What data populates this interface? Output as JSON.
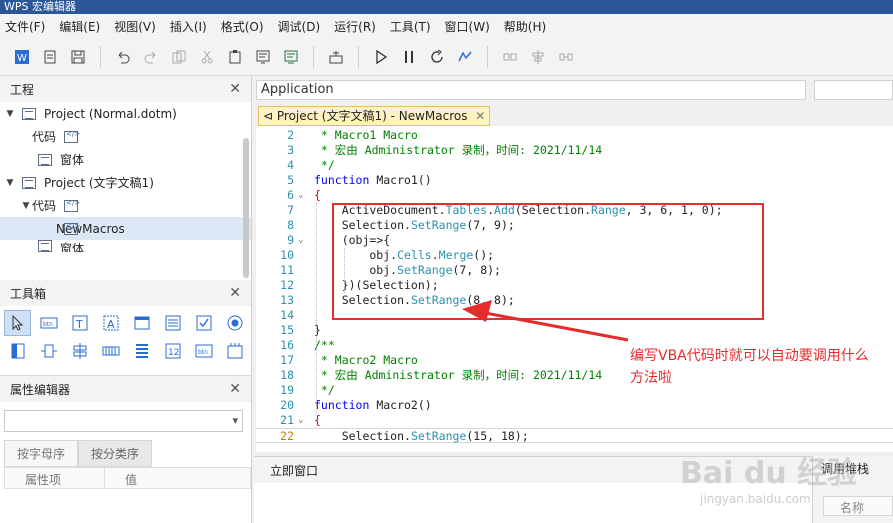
{
  "app": {
    "title": "WPS 宏编辑器"
  },
  "menu": [
    "文件(F)",
    "编辑(E)",
    "视图(V)",
    "插入(I)",
    "格式(O)",
    "调试(D)",
    "运行(R)",
    "工具(T)",
    "窗口(W)",
    "帮助(H)"
  ],
  "project_panel": {
    "title": "工程",
    "items": [
      {
        "label": "Project (Normal.dotm)",
        "level": 0,
        "icon": "project-icon"
      },
      {
        "label": "代码",
        "level": 1,
        "icon": "code-module-icon"
      },
      {
        "label": "窗体",
        "level": 1,
        "icon": "form-icon"
      },
      {
        "label": "Project (文字文稿1)",
        "level": 0,
        "icon": "project-icon"
      },
      {
        "label": "代码",
        "level": 1,
        "icon": "code-module-icon"
      },
      {
        "label": "NewMacros",
        "level": 2,
        "icon": "code-module-icon",
        "selected": true
      },
      {
        "label": "窗体",
        "level": 1,
        "icon": "form-icon"
      }
    ]
  },
  "toolbox_panel": {
    "title": "工具箱"
  },
  "properties_panel": {
    "title": "属性编辑器",
    "tabs": [
      "按字母序",
      "按分类序"
    ],
    "columns": [
      "属性项",
      "值"
    ]
  },
  "editor": {
    "object_combo": "Application",
    "doc_tab": "Project (文字文稿1) - NewMacros",
    "lines": [
      {
        "n": "2",
        "text": " * Macro1 Macro",
        "type": "cm"
      },
      {
        "n": "3",
        "text": " * 宏由 Administrator 录制，时间: 2021/11/14",
        "type": "cm"
      },
      {
        "n": "4",
        "text": " */",
        "type": "cm"
      },
      {
        "n": "5",
        "text": "function Macro1()",
        "type": "fnline"
      },
      {
        "n": "6",
        "text": "{",
        "type": "plain"
      },
      {
        "n": "7",
        "text": "    ActiveDocument.Tables.Add(Selection.Range, 3, 6, 1, 0);",
        "type": "plain"
      },
      {
        "n": "8",
        "text": "    Selection.SetRange(7, 9);",
        "type": "plain"
      },
      {
        "n": "9",
        "text": "    (obj=>{",
        "type": "plain"
      },
      {
        "n": "10",
        "text": "        obj.Cells.Merge();",
        "type": "plain"
      },
      {
        "n": "11",
        "text": "        obj.SetRange(7, 8);",
        "type": "plain"
      },
      {
        "n": "12",
        "text": "    })(Selection);",
        "type": "plain"
      },
      {
        "n": "13",
        "text": "    Selection.SetRange(8, 8);",
        "type": "plain"
      },
      {
        "n": "14",
        "text": "",
        "type": "plain"
      },
      {
        "n": "15",
        "text": "}",
        "type": "plain"
      },
      {
        "n": "16",
        "text": "/**",
        "type": "cm"
      },
      {
        "n": "17",
        "text": " * Macro2 Macro",
        "type": "cm"
      },
      {
        "n": "18",
        "text": " * 宏由 Administrator 录制，时间: 2021/11/14",
        "type": "cm"
      },
      {
        "n": "19",
        "text": " */",
        "type": "cm"
      },
      {
        "n": "20",
        "text": "function Macro2()",
        "type": "fnline"
      },
      {
        "n": "21",
        "text": "{",
        "type": "plain"
      },
      {
        "n": "22",
        "text": "    Selection.SetRange(15, 18);",
        "type": "plain"
      }
    ]
  },
  "annotation": "编写VBA代码时就可以自动要调用什么方法啦",
  "immediate_panel": {
    "title": "立即窗口"
  },
  "callstack_panel": {
    "title": "调用堆栈",
    "column": "名称"
  },
  "watermark": {
    "main": "Bai du 经验",
    "sub": "jingyan.baidu.com"
  }
}
